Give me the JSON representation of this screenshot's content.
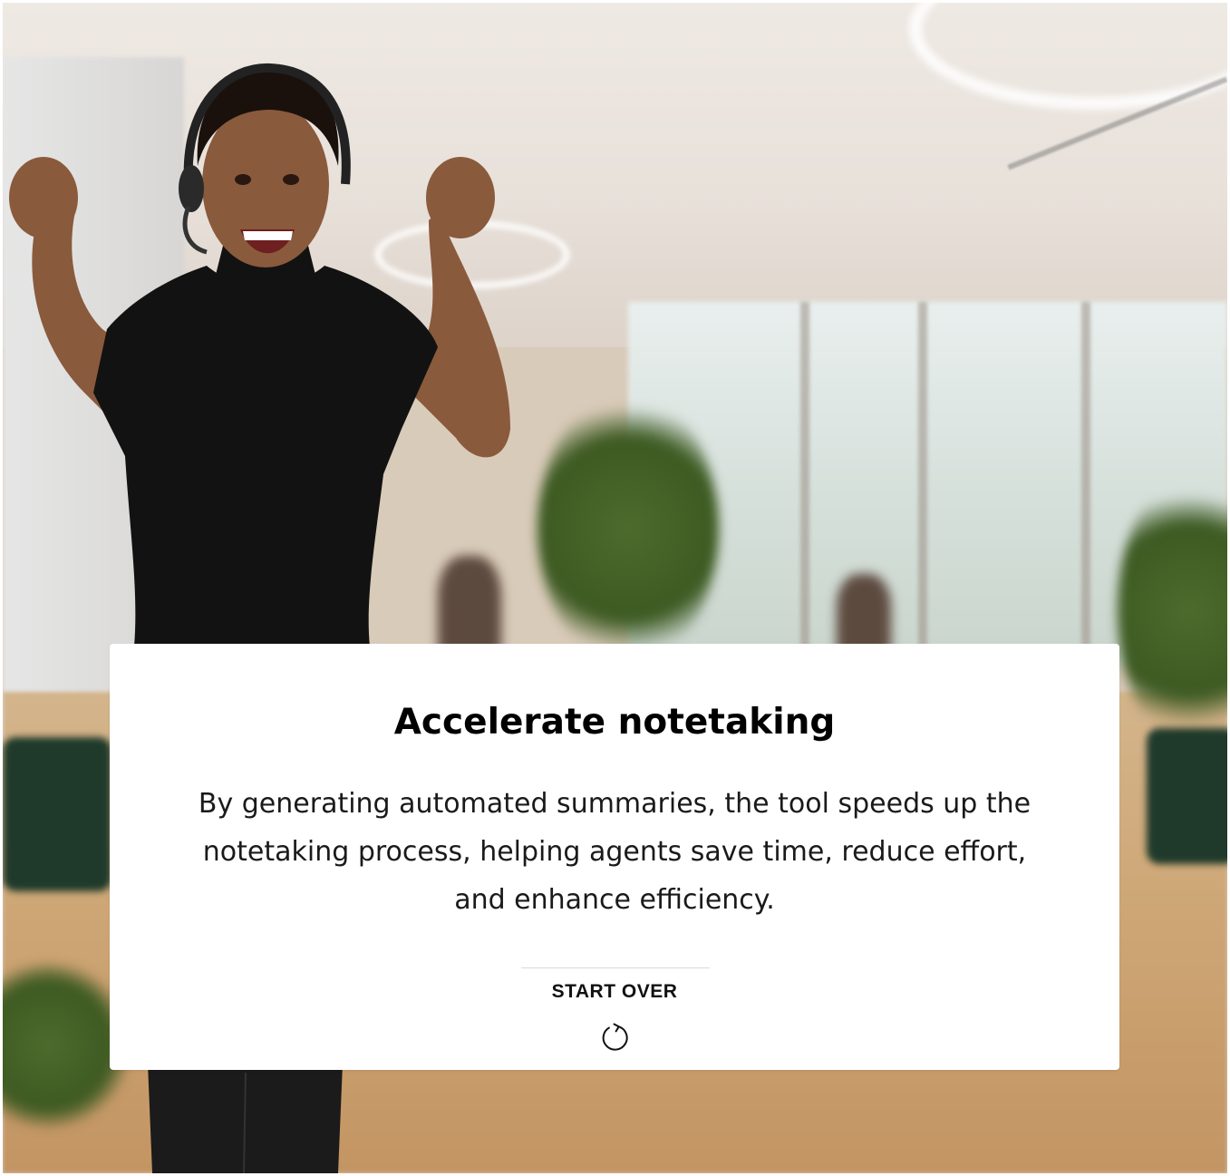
{
  "card": {
    "title": "Accelerate notetaking",
    "body": "By generating automated summaries, the tool speeds up the notetaking process, helping agents save time, reduce effort, and enhance efficiency.",
    "start_over_label": "START OVER",
    "start_over_icon": "restart-icon"
  },
  "colors": {
    "card_background": "#ffffff",
    "title_text": "#000000",
    "body_text": "#1a1a1a",
    "divider": "#d9d9d9"
  }
}
